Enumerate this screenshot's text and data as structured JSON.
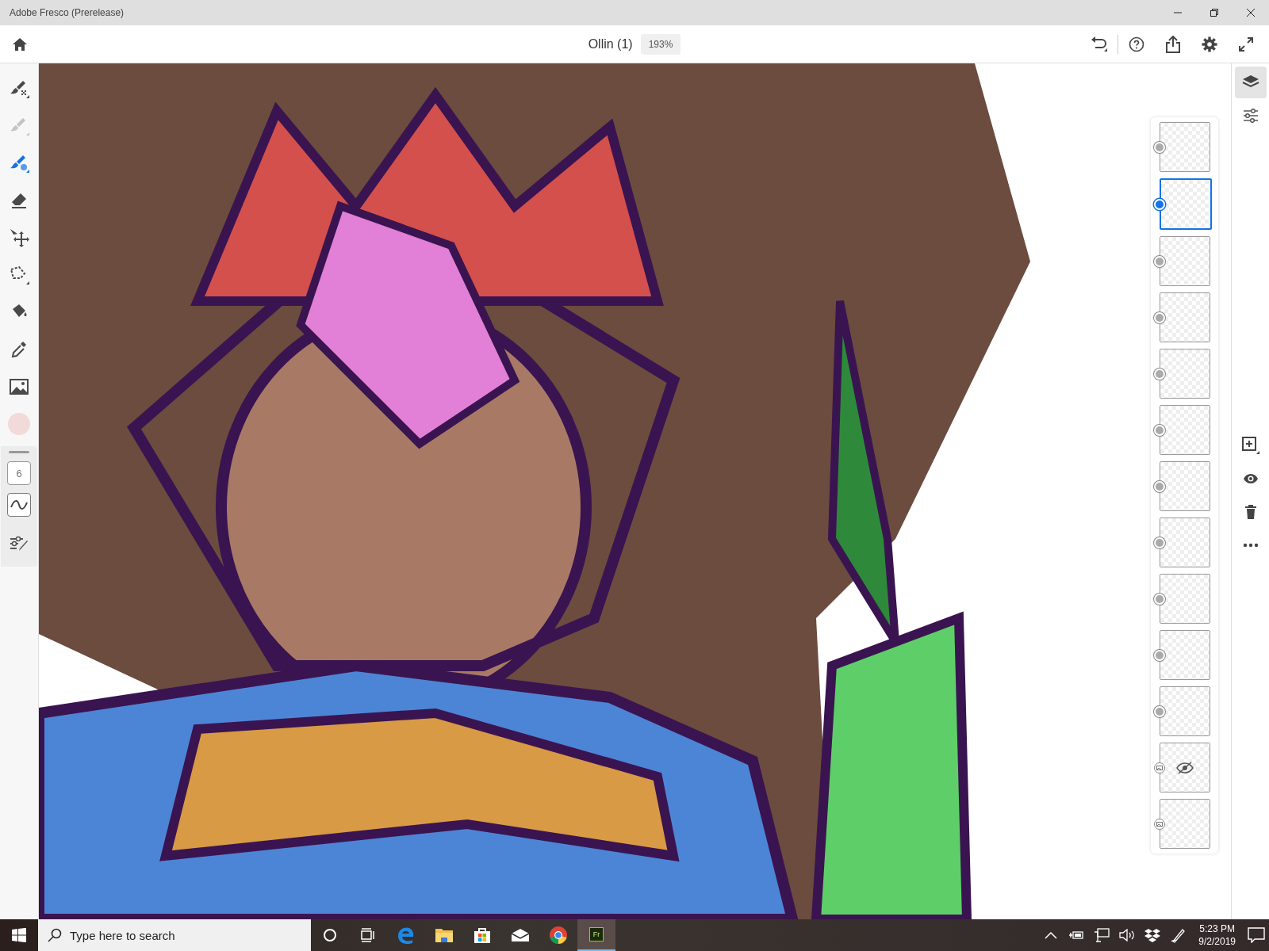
{
  "window": {
    "title": "Adobe Fresco (Prerelease)"
  },
  "toolbar": {
    "document_title": "Ollin (1)",
    "zoom": "193%"
  },
  "tools": [
    {
      "kind": "pixel-brush",
      "selected": false,
      "disabled": false
    },
    {
      "kind": "live-brush",
      "selected": false,
      "disabled": true
    },
    {
      "kind": "vector-brush",
      "selected": true,
      "disabled": false
    },
    {
      "kind": "eraser",
      "selected": false,
      "disabled": false
    },
    {
      "kind": "move",
      "selected": false,
      "disabled": false
    },
    {
      "kind": "lasso",
      "selected": false,
      "disabled": false
    },
    {
      "kind": "fill",
      "selected": false,
      "disabled": false
    },
    {
      "kind": "eyedropper",
      "selected": false,
      "disabled": false
    },
    {
      "kind": "image",
      "selected": false,
      "disabled": false
    }
  ],
  "current_color": {
    "color": "#f2dada"
  },
  "brush_size": "6",
  "layers": [
    {
      "kind": "paint",
      "selected": false,
      "hidden": false
    },
    {
      "kind": "paint",
      "selected": true,
      "hidden": false
    },
    {
      "kind": "paint",
      "selected": false,
      "hidden": false
    },
    {
      "kind": "paint",
      "selected": false,
      "hidden": false
    },
    {
      "kind": "paint",
      "selected": false,
      "hidden": false
    },
    {
      "kind": "paint",
      "selected": false,
      "hidden": false
    },
    {
      "kind": "paint",
      "selected": false,
      "hidden": false
    },
    {
      "kind": "paint",
      "selected": false,
      "hidden": false
    },
    {
      "kind": "paint",
      "selected": false,
      "hidden": false
    },
    {
      "kind": "paint",
      "selected": false,
      "hidden": false
    },
    {
      "kind": "paint",
      "selected": false,
      "hidden": false
    },
    {
      "kind": "image",
      "selected": false,
      "hidden": true
    },
    {
      "kind": "image",
      "selected": false,
      "hidden": false
    }
  ],
  "taskbar": {
    "search_placeholder": "Type here to search",
    "fresco_label": "Fr",
    "time": "5:23 PM",
    "date": "9/2/2019"
  }
}
